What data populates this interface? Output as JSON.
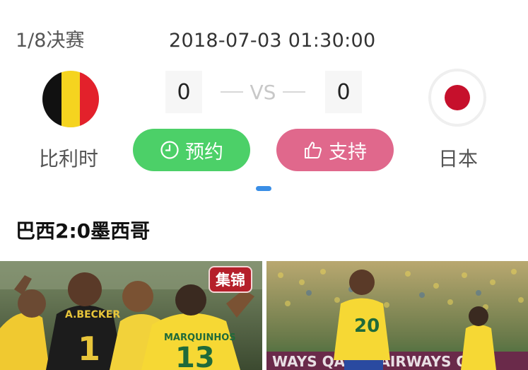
{
  "match": {
    "stage": "1/8决赛",
    "datetime": "2018-07-03 01:30:00",
    "home": {
      "name": "比利时",
      "score": "0",
      "flag_colors": [
        "#111111",
        "#f5d41f",
        "#e3212b"
      ]
    },
    "away": {
      "name": "日本",
      "score": "0",
      "flag_colors": [
        "#ffffff",
        "#c6102c"
      ]
    },
    "vs_label": "VS"
  },
  "buttons": {
    "reserve": {
      "label": "预约",
      "icon": "clock-icon",
      "color": "#4cd068"
    },
    "support": {
      "label": "支持",
      "icon": "thumbs-up-icon",
      "color": "#e0688c"
    }
  },
  "pager": {
    "active_color": "#3a8ee6"
  },
  "section": {
    "title": "巴西2:0墨西哥",
    "videos": [
      {
        "thumbnail": "highlight-photo-left",
        "badge": "集锦"
      },
      {
        "thumbnail": "highlight-photo-right"
      }
    ]
  }
}
